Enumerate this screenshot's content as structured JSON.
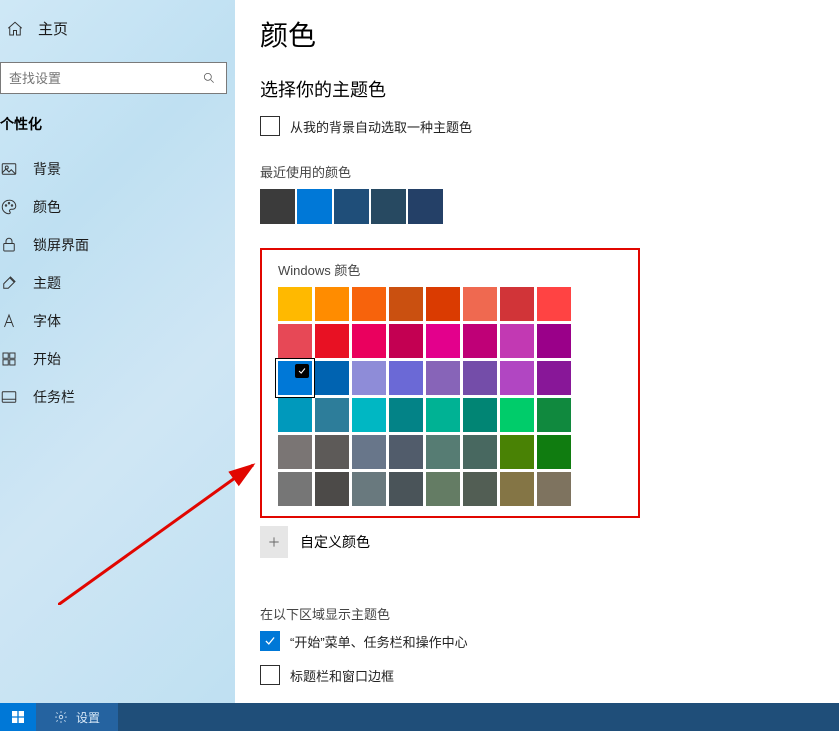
{
  "sidebar": {
    "home_label": "主页",
    "search_placeholder": "查找设置",
    "section_label": "个性化",
    "items": [
      {
        "icon": "picture-icon",
        "label": "背景"
      },
      {
        "icon": "palette-icon",
        "label": "颜色"
      },
      {
        "icon": "lock-icon",
        "label": "锁屏界面"
      },
      {
        "icon": "brush-icon",
        "label": "主题"
      },
      {
        "icon": "font-icon",
        "label": "字体"
      },
      {
        "icon": "start-icon",
        "label": "开始"
      },
      {
        "icon": "taskbar-icon",
        "label": "任务栏"
      }
    ]
  },
  "main": {
    "title": "颜色",
    "accent_heading": "选择你的主题色",
    "auto_from_bg_label": "从我的背景自动选取一种主题色",
    "recent_label": "最近使用的颜色",
    "recent_colors": [
      "#3b3b3b",
      "#0078d7",
      "#1f4e79",
      "#274961",
      "#244067"
    ],
    "palette_label": "Windows 颜色",
    "palette": [
      "#ffb900",
      "#ff8c00",
      "#f7630c",
      "#ca5010",
      "#da3b01",
      "#ef6950",
      "#d13438",
      "#ff4343",
      "#e74856",
      "#e81123",
      "#ea005e",
      "#c30052",
      "#e3008c",
      "#bf0077",
      "#c239b3",
      "#9a0089",
      "#0078d7",
      "#0063b1",
      "#8e8cd8",
      "#6b69d6",
      "#8764b8",
      "#744da9",
      "#b146c2",
      "#881798",
      "#0099bc",
      "#2d7d9a",
      "#00b7c3",
      "#038387",
      "#00b294",
      "#018574",
      "#00cc6a",
      "#10893e",
      "#7a7574",
      "#5d5a58",
      "#68768a",
      "#515c6b",
      "#567c73",
      "#486860",
      "#498205",
      "#107c10",
      "#767676",
      "#4c4a48",
      "#69797e",
      "#4a5459",
      "#647c64",
      "#525e54",
      "#847545",
      "#7e735f"
    ],
    "selected_index": 16,
    "custom_color_label": "自定义颜色",
    "surfaces_heading": "在以下区域显示主题色",
    "surfaces": [
      {
        "label": "“开始”菜单、任务栏和操作中心",
        "checked": true
      },
      {
        "label": "标题栏和窗口边框",
        "checked": false
      }
    ]
  },
  "taskbar": {
    "app_label": "设置"
  }
}
